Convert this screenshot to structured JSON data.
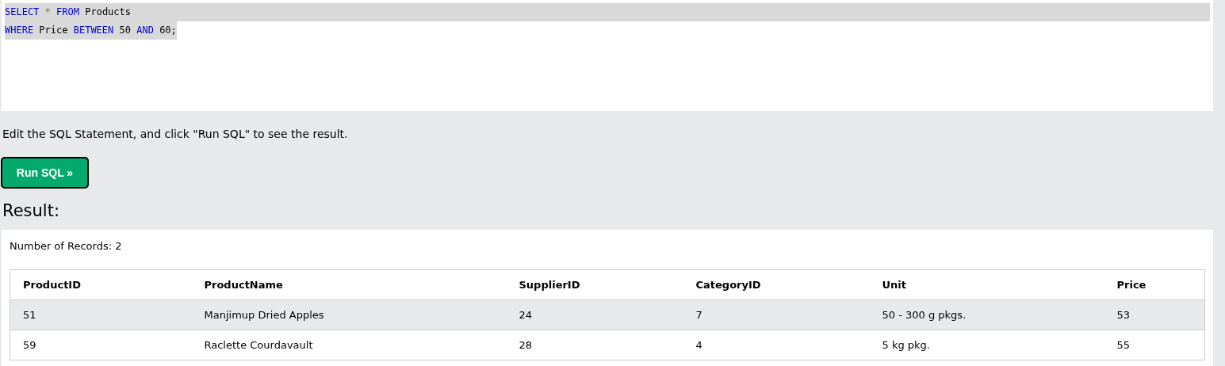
{
  "editor": {
    "lines": [
      {
        "selected": true,
        "tokens": [
          {
            "kind": "keyword",
            "text": "SELECT"
          },
          {
            "kind": "operator",
            "text": "*"
          },
          {
            "kind": "keyword",
            "text": "FROM"
          },
          {
            "kind": "text",
            "text": "Products"
          }
        ]
      },
      {
        "selected": true,
        "tokens": [
          {
            "kind": "keyword",
            "text": "WHERE"
          },
          {
            "kind": "text",
            "text": "Price"
          },
          {
            "kind": "keyword",
            "text": "BETWEEN"
          },
          {
            "kind": "text",
            "text": "50"
          },
          {
            "kind": "keyword",
            "text": "AND"
          },
          {
            "kind": "text",
            "text": "60;"
          }
        ]
      }
    ]
  },
  "instruction": "Edit the SQL Statement, and click \"Run SQL\" to see the result.",
  "run_button": "Run SQL »",
  "result_heading": "Result:",
  "result": {
    "record_count": "Number of Records: 2",
    "table": {
      "columns": [
        "ProductID",
        "ProductName",
        "SupplierID",
        "CategoryID",
        "Unit",
        "Price"
      ],
      "rows": [
        [
          "51",
          "Manjimup Dried Apples",
          "24",
          "7",
          "50 - 300 g pkgs.",
          "53"
        ],
        [
          "59",
          "Raclette Courdavault",
          "28",
          "4",
          "5 kg pkg.",
          "55"
        ]
      ]
    }
  }
}
